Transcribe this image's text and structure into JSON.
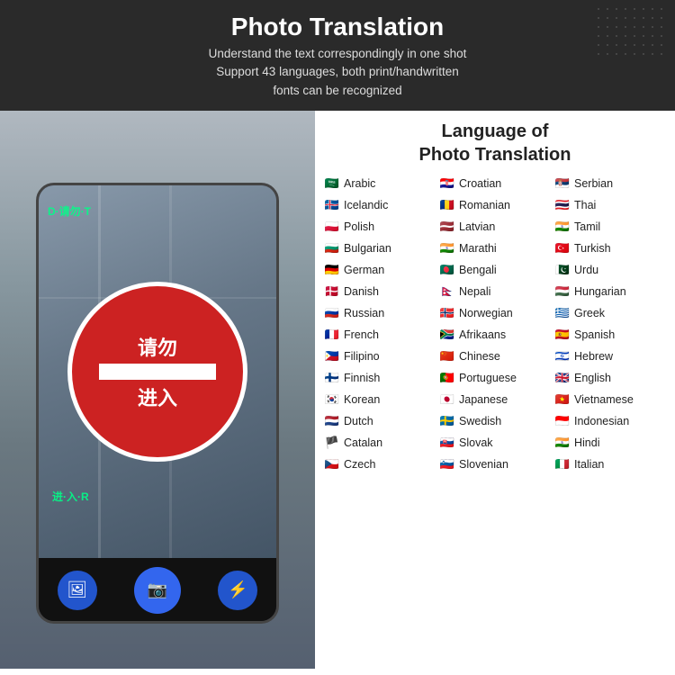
{
  "header": {
    "title": "Photo Translation",
    "subtitle_line1": "Understand the text correspondingly in one shot",
    "subtitle_line2": "Support 43 languages, both print/handwritten",
    "subtitle_line3": "fonts can be recognized"
  },
  "lang_section": {
    "title_line1": "Language of",
    "title_line2": "Photo Translation"
  },
  "languages": {
    "col1": [
      {
        "name": "Arabic",
        "flag": "🇸🇦"
      },
      {
        "name": "Icelandic",
        "flag": "🇮🇸"
      },
      {
        "name": "Polish",
        "flag": "🇵🇱"
      },
      {
        "name": "Bulgarian",
        "flag": "🇧🇬"
      },
      {
        "name": "German",
        "flag": "🇩🇪"
      },
      {
        "name": "Danish",
        "flag": "🇩🇰"
      },
      {
        "name": "Russian",
        "flag": "🇷🇺"
      },
      {
        "name": "French",
        "flag": "🇫🇷"
      },
      {
        "name": "Filipino",
        "flag": "🇵🇭"
      },
      {
        "name": "Finnish",
        "flag": "🇫🇮"
      },
      {
        "name": "Korean",
        "flag": "🇰🇷"
      },
      {
        "name": "Dutch",
        "flag": "🇳🇱"
      },
      {
        "name": "Catalan",
        "flag": "🏴"
      },
      {
        "name": "Czech",
        "flag": "🇨🇿"
      }
    ],
    "col2": [
      {
        "name": "Croatian",
        "flag": "🇭🇷"
      },
      {
        "name": "Romanian",
        "flag": "🇷🇴"
      },
      {
        "name": "Latvian",
        "flag": "🇱🇻"
      },
      {
        "name": "Marathi",
        "flag": "🇮🇳"
      },
      {
        "name": "Bengali",
        "flag": "🇧🇩"
      },
      {
        "name": "Nepali",
        "flag": "🇳🇵"
      },
      {
        "name": "Norwegian",
        "flag": "🇳🇴"
      },
      {
        "name": "Afrikaans",
        "flag": "🇿🇦"
      },
      {
        "name": "Chinese",
        "flag": "🇨🇳"
      },
      {
        "name": "Portuguese",
        "flag": "🇵🇹"
      },
      {
        "name": "Japanese",
        "flag": "🇯🇵"
      },
      {
        "name": "Swedish",
        "flag": "🇸🇪"
      },
      {
        "name": "Slovak",
        "flag": "🇸🇰"
      },
      {
        "name": "Slovenian",
        "flag": "🇸🇮"
      }
    ],
    "col3": [
      {
        "name": "Serbian",
        "flag": "🇷🇸"
      },
      {
        "name": "Thai",
        "flag": "🇹🇭"
      },
      {
        "name": "Tamil",
        "flag": "🇮🇳"
      },
      {
        "name": "Turkish",
        "flag": "🇹🇷"
      },
      {
        "name": "Urdu",
        "flag": "🇵🇰"
      },
      {
        "name": "Hungarian",
        "flag": "🇭🇺"
      },
      {
        "name": "Greek",
        "flag": "🇬🇷"
      },
      {
        "name": "Spanish",
        "flag": "🇪🇸"
      },
      {
        "name": "Hebrew",
        "flag": "🇮🇱"
      },
      {
        "name": "English",
        "flag": "🇬🇧"
      },
      {
        "name": "Vietnamese",
        "flag": "🇻🇳"
      },
      {
        "name": "Indonesian",
        "flag": "🇮🇩"
      },
      {
        "name": "Hindi",
        "flag": "🇮🇳"
      },
      {
        "name": "Italian",
        "flag": "🇮🇹"
      }
    ]
  },
  "device_buttons": {
    "btn1": "🖼",
    "btn2": "📷",
    "btn3": "⚡"
  }
}
